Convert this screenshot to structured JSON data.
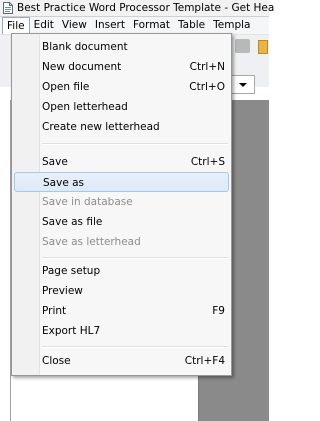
{
  "window": {
    "title": "Best Practice Word Processor Template - Get Hea"
  },
  "menubar": {
    "items": [
      "File",
      "Edit",
      "View",
      "Insert",
      "Format",
      "Table",
      "Templa"
    ]
  },
  "file_menu": {
    "items": [
      {
        "label": "Blank document",
        "shortcut": "",
        "enabled": true
      },
      {
        "label": "New document",
        "shortcut": "Ctrl+N",
        "enabled": true
      },
      {
        "label": "Open file",
        "shortcut": "Ctrl+O",
        "enabled": true
      },
      {
        "label": "Open letterhead",
        "shortcut": "",
        "enabled": true
      },
      {
        "label": "Create new letterhead",
        "shortcut": "",
        "enabled": true
      },
      {
        "label": "Save",
        "shortcut": "Ctrl+S",
        "enabled": true
      },
      {
        "label": "Save as",
        "shortcut": "",
        "enabled": true,
        "highlighted": true
      },
      {
        "label": "Save in database",
        "shortcut": "",
        "enabled": false
      },
      {
        "label": "Save as file",
        "shortcut": "",
        "enabled": true
      },
      {
        "label": "Save as letterhead",
        "shortcut": "",
        "enabled": false
      },
      {
        "label": "Page setup",
        "shortcut": "",
        "enabled": true
      },
      {
        "label": "Preview",
        "shortcut": "",
        "enabled": true
      },
      {
        "label": "Print",
        "shortcut": "F9",
        "enabled": true
      },
      {
        "label": "Export HL7",
        "shortcut": "",
        "enabled": true
      },
      {
        "label": "Close",
        "shortcut": "Ctrl+F4",
        "enabled": true
      }
    ]
  },
  "icons": {
    "title_icon": "document-icon"
  }
}
